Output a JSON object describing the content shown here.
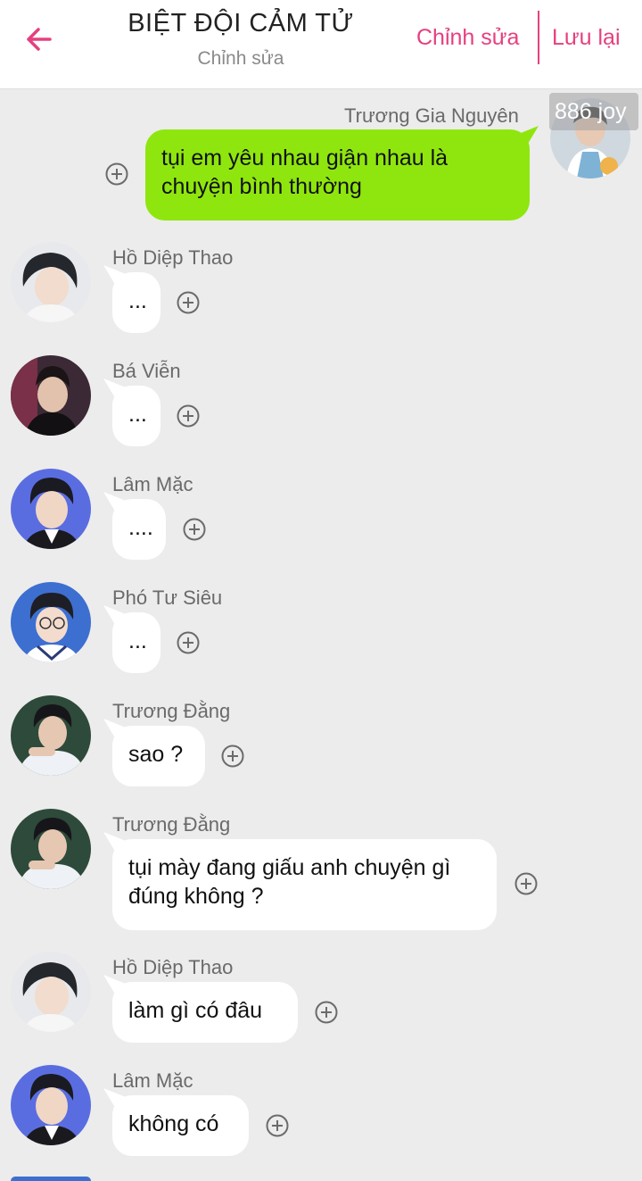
{
  "header": {
    "title": "BIỆT ĐỘI CẢM TỬ",
    "subtitle": "Chỉnh sửa",
    "edit_label": "Chỉnh sửa",
    "save_label": "Lưu lại",
    "back_icon": "arrow-left-icon"
  },
  "colors": {
    "accent": "#e5407f",
    "own_bubble": "#8fe60e",
    "bubble": "#ffffff",
    "background": "#ececec"
  },
  "messages": [
    {
      "sender": "Trương Gia Nguyên",
      "text_lines": [
        "tụi em yêu nhau giận nhau là",
        "chuyện bình thường"
      ],
      "side": "right",
      "avatar_badge": "886 joy"
    },
    {
      "sender": "Hồ Diệp Thao",
      "text_lines": [
        "..."
      ],
      "side": "left"
    },
    {
      "sender": "Bá Viễn",
      "text_lines": [
        "..."
      ],
      "side": "left"
    },
    {
      "sender": "Lâm Mặc",
      "text_lines": [
        "...."
      ],
      "side": "left"
    },
    {
      "sender": "Phó Tư Siêu",
      "text_lines": [
        "..."
      ],
      "side": "left"
    },
    {
      "sender": "Trương Đằng",
      "text_lines": [
        "sao ?"
      ],
      "side": "left"
    },
    {
      "sender": "Trương Đằng",
      "text_lines": [
        "tụi mày đang giấu anh chuyện gì",
        "đúng không ?"
      ],
      "side": "left"
    },
    {
      "sender": "Hồ Diệp Thao",
      "text_lines": [
        "làm gì có đâu"
      ],
      "side": "left"
    },
    {
      "sender": "Lâm Mặc",
      "text_lines": [
        "không có"
      ],
      "side": "left"
    }
  ]
}
